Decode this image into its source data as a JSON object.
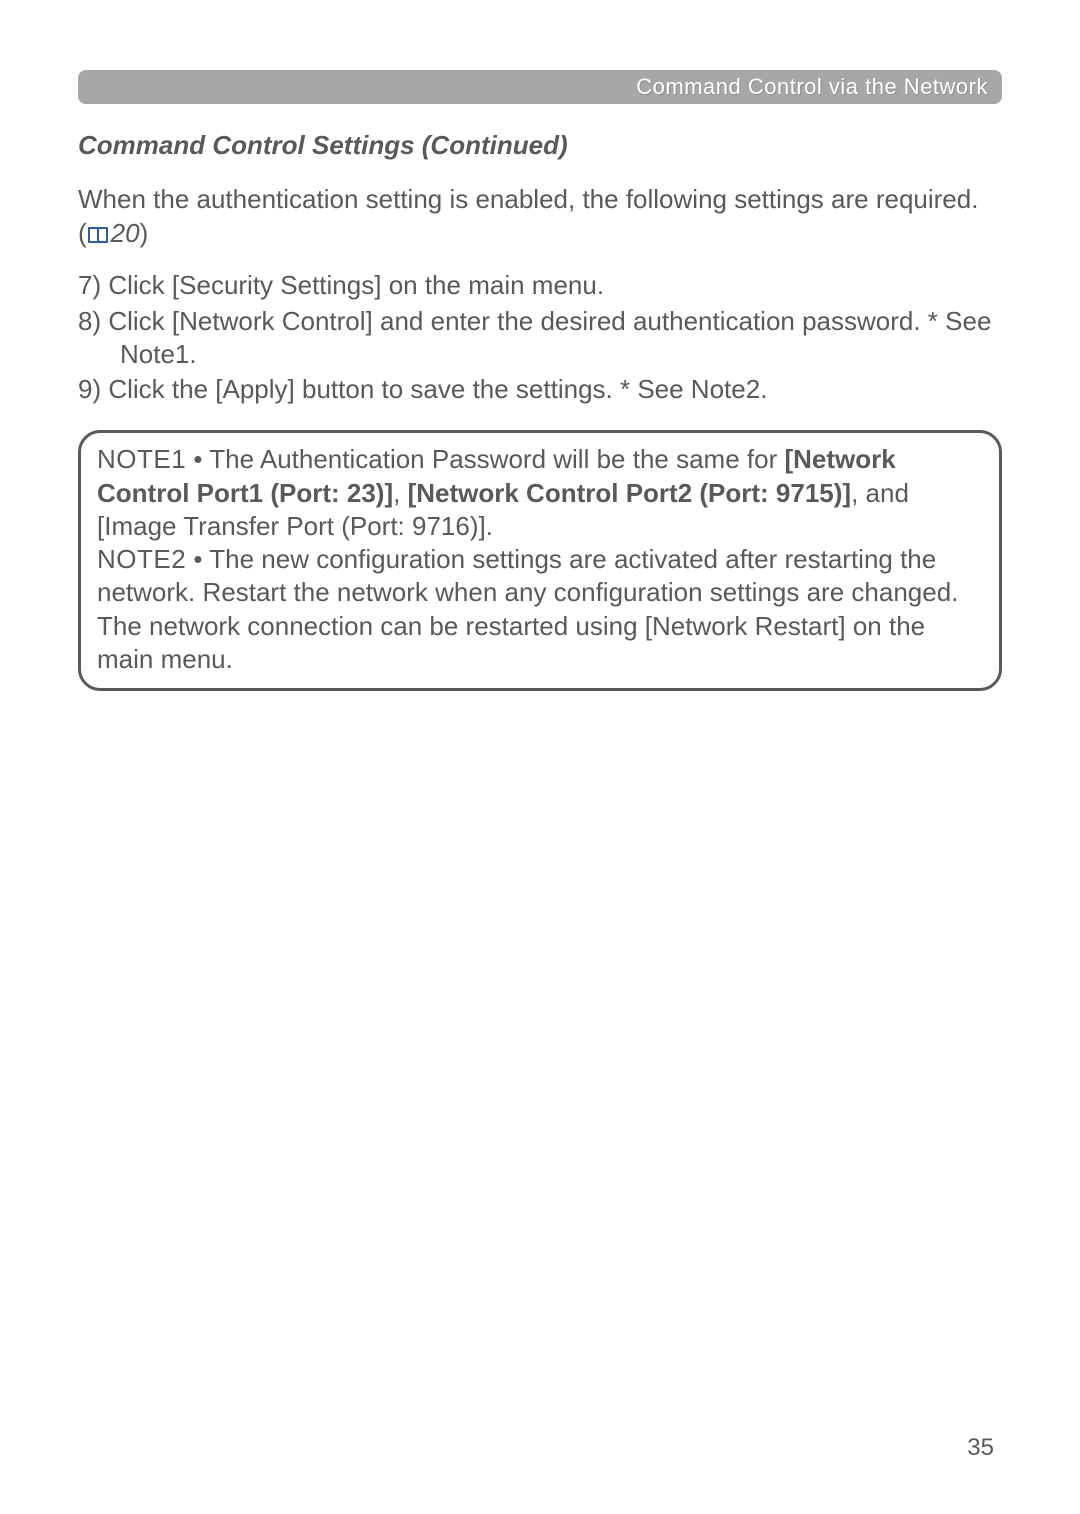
{
  "header": {
    "breadcrumb": "Command Control via the Network"
  },
  "section": {
    "title": "Command Control Settings (Continued)"
  },
  "intro": {
    "line": "When the authentication setting is enabled, the following settings are required.",
    "ref_open": "(",
    "ref_num": "20",
    "ref_close": ")"
  },
  "steps": {
    "s7_pre": "7) Click ",
    "s7_ui_open": "[",
    "s7_ui": "Security Settings",
    "s7_ui_close": "]",
    "s7_post": " on the main menu.",
    "s8_pre": "8) Click ",
    "s8_ui_open": "[",
    "s8_ui": "Network Control",
    "s8_ui_close": "]",
    "s8_post": " and enter the desired authentication password. * See Note1.",
    "s9_pre": "9) Click the ",
    "s9_ui_open": "[",
    "s9_ui": "Apply",
    "s9_ui_close": "]",
    "s9_post": " button to save the settings. * See Note2."
  },
  "notes": {
    "n1_label": "NOTE1",
    "n1_a": "  • The Authentication Password will be the same for ",
    "n1_b_open": "[",
    "n1_b": "Network Control Port1 (Port: 23)",
    "n1_b_close": "]",
    "n1_comma": ", ",
    "n1_c_open": "[",
    "n1_c": "Network Control Port2 (Port: 9715)",
    "n1_c_close": "]",
    "n1_and": ", and ",
    "n1_d_open": "[",
    "n1_d": "Image Transfer Port (Port: 9716)",
    "n1_d_close": "]",
    "n1_period": ".",
    "n2_label": "NOTE2",
    "n2_a": "  • The new configuration settings are activated after restarting the network. Restart the network when any configuration settings are changed. The network connection can be restarted using ",
    "n2_b_open": "[",
    "n2_b": "Network Restart",
    "n2_b_close": "]",
    "n2_c": " on the main menu."
  },
  "page_number": "35"
}
